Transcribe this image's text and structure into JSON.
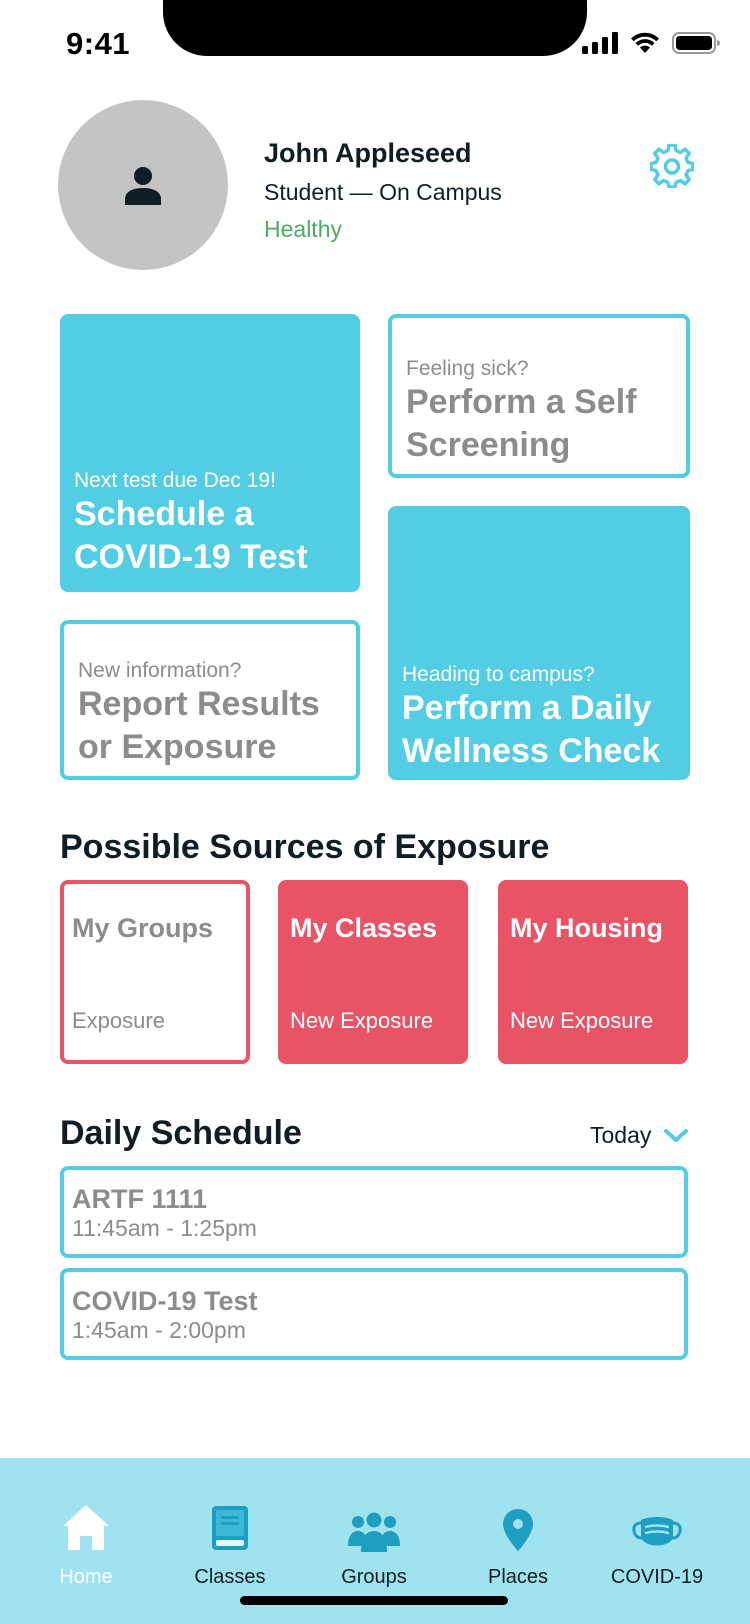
{
  "status_bar": {
    "time": "9:41"
  },
  "profile": {
    "name": "John Appleseed",
    "role": "Student — On Campus",
    "health_status": "Healthy",
    "health_color": "#4bab60"
  },
  "actions": {
    "schedule_test": {
      "subtitle": "Next test due Dec 19!",
      "title": "Schedule a COVID-19 Test"
    },
    "self_screening": {
      "subtitle": "Feeling sick?",
      "title": "Perform a Self Screening"
    },
    "report_results": {
      "subtitle": "New information?",
      "title": "Report Results or Exposure"
    },
    "wellness_check": {
      "subtitle": "Heading to campus?",
      "title": "Perform a Daily Wellness Check"
    }
  },
  "exposure": {
    "heading": "Possible Sources of Exposure",
    "tiles": [
      {
        "name": "My Groups",
        "status": "Exposure"
      },
      {
        "name": "My Classes",
        "status": "New Exposure"
      },
      {
        "name": "My Housing",
        "status": "New Exposure"
      }
    ]
  },
  "schedule": {
    "heading": "Daily Schedule",
    "filter": "Today",
    "items": [
      {
        "title": "ARTF 1111",
        "time": "11:45am - 1:25pm"
      },
      {
        "title": "COVID-19 Test",
        "time": "1:45am - 2:00pm"
      }
    ]
  },
  "tabbar": {
    "tabs": [
      {
        "label": "Home",
        "icon": "home-icon",
        "active": true
      },
      {
        "label": "Classes",
        "icon": "book-icon",
        "active": false
      },
      {
        "label": "Groups",
        "icon": "group-icon",
        "active": false
      },
      {
        "label": "Places",
        "icon": "location-pin-icon",
        "active": false
      },
      {
        "label": "COVID-19",
        "icon": "mask-icon",
        "active": false
      }
    ]
  },
  "colors": {
    "accent": "#52cde4",
    "alert": "#e85465",
    "tabbar": "#9fe2f0",
    "muted_text": "#8c8c8c"
  }
}
